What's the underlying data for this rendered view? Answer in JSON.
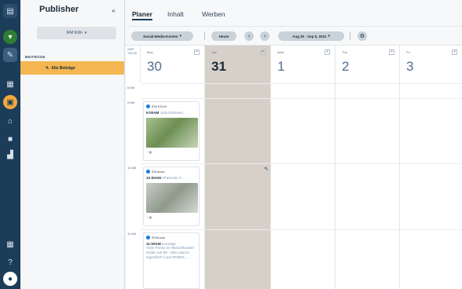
{
  "rail": {
    "icons": [
      "publisher-logo-icon",
      "green-status-icon",
      "compose-icon",
      "grid-icon",
      "calendar-icon",
      "inbox-icon",
      "lock-icon",
      "analytics-icon",
      "apps-icon",
      "help-icon",
      "user-icon"
    ]
  },
  "sidebar": {
    "title": "Publisher",
    "profile": "IFM Köln",
    "section": "BEITRÄGE",
    "item": "Alle Beiträge"
  },
  "tabs": [
    {
      "label": "Planer"
    },
    {
      "label": "Inhalt"
    },
    {
      "label": "Werben"
    }
  ],
  "toolbar": {
    "accounts": "Social-Media-Konten",
    "today": "Heute",
    "range": "Aug 30 - Sep 5, 2021"
  },
  "calendar": {
    "tz_lines": [
      "GMT",
      "+02:00"
    ],
    "days": [
      {
        "weekday": "Mon",
        "num": "30"
      },
      {
        "weekday": "Tue",
        "num": "31"
      },
      {
        "weekday": "Wed",
        "num": "1"
      },
      {
        "weekday": "Thu",
        "num": "2"
      },
      {
        "weekday": "Fri",
        "num": "3"
      }
    ],
    "times": [
      "8 AM",
      "9 AM",
      "10 AM",
      "11 AM"
    ],
    "posts": [
      {
        "account": "IFM KÖLN",
        "time": "9:00AM",
        "text": " Julia Erdmann, ..."
      },
      {
        "account": "IDEAsolo",
        "time": "10:00AM",
        "text": " #Patoesin #..."
      },
      {
        "account": "IFMKoeln",
        "time": "11:00AM",
        "text": " Kunstige",
        "extra": "Viele Preise im #Einzelhandel enden auf 99 - aber warum eigentlich? Laut #FMZS..."
      }
    ]
  }
}
